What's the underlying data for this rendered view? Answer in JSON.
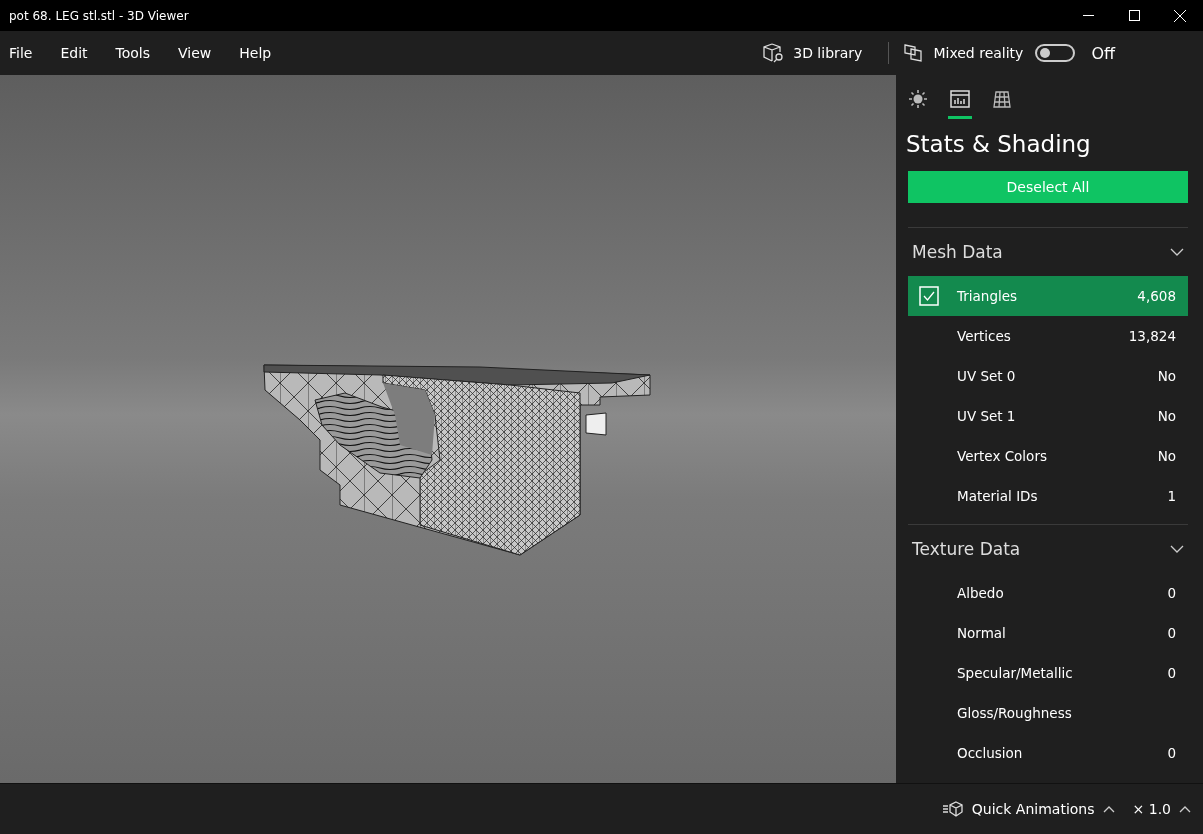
{
  "window": {
    "title": "pot 68. LEG stl.stl - 3D Viewer"
  },
  "menu": [
    "File",
    "Edit",
    "Tools",
    "View",
    "Help"
  ],
  "toolbar": {
    "library": "3D library",
    "mixed_reality": {
      "label": "Mixed reality",
      "on": false,
      "state_text": "Off"
    }
  },
  "panel": {
    "tabs": [
      {
        "kind": "lighting",
        "selected": false
      },
      {
        "kind": "stats",
        "selected": true
      },
      {
        "kind": "grid",
        "selected": false
      }
    ],
    "title": "Stats & Shading",
    "button": "Deselect All",
    "sections": [
      {
        "title": "Mesh Data",
        "expanded": true,
        "rows": [
          {
            "label": "Triangles",
            "value": "4,608",
            "selected": true
          },
          {
            "label": "Vertices",
            "value": "13,824",
            "selected": false
          },
          {
            "label": "UV Set 0",
            "value": "No",
            "selected": false
          },
          {
            "label": "UV Set 1",
            "value": "No",
            "selected": false
          },
          {
            "label": "Vertex Colors",
            "value": "No",
            "selected": false
          },
          {
            "label": "Material IDs",
            "value": "1",
            "selected": false
          }
        ]
      },
      {
        "title": "Texture Data",
        "expanded": true,
        "rows": [
          {
            "label": "Albedo",
            "value": "0",
            "selected": false
          },
          {
            "label": "Normal",
            "value": "0",
            "selected": false
          },
          {
            "label": "Specular/Metallic",
            "value": "0",
            "selected": false
          },
          {
            "label": "Gloss/Roughness",
            "value": "",
            "selected": false
          },
          {
            "label": "Occlusion",
            "value": "0",
            "selected": false
          }
        ]
      }
    ]
  },
  "bottom_bar": {
    "animations": "Quick Animations",
    "speed": "× 1.0"
  }
}
